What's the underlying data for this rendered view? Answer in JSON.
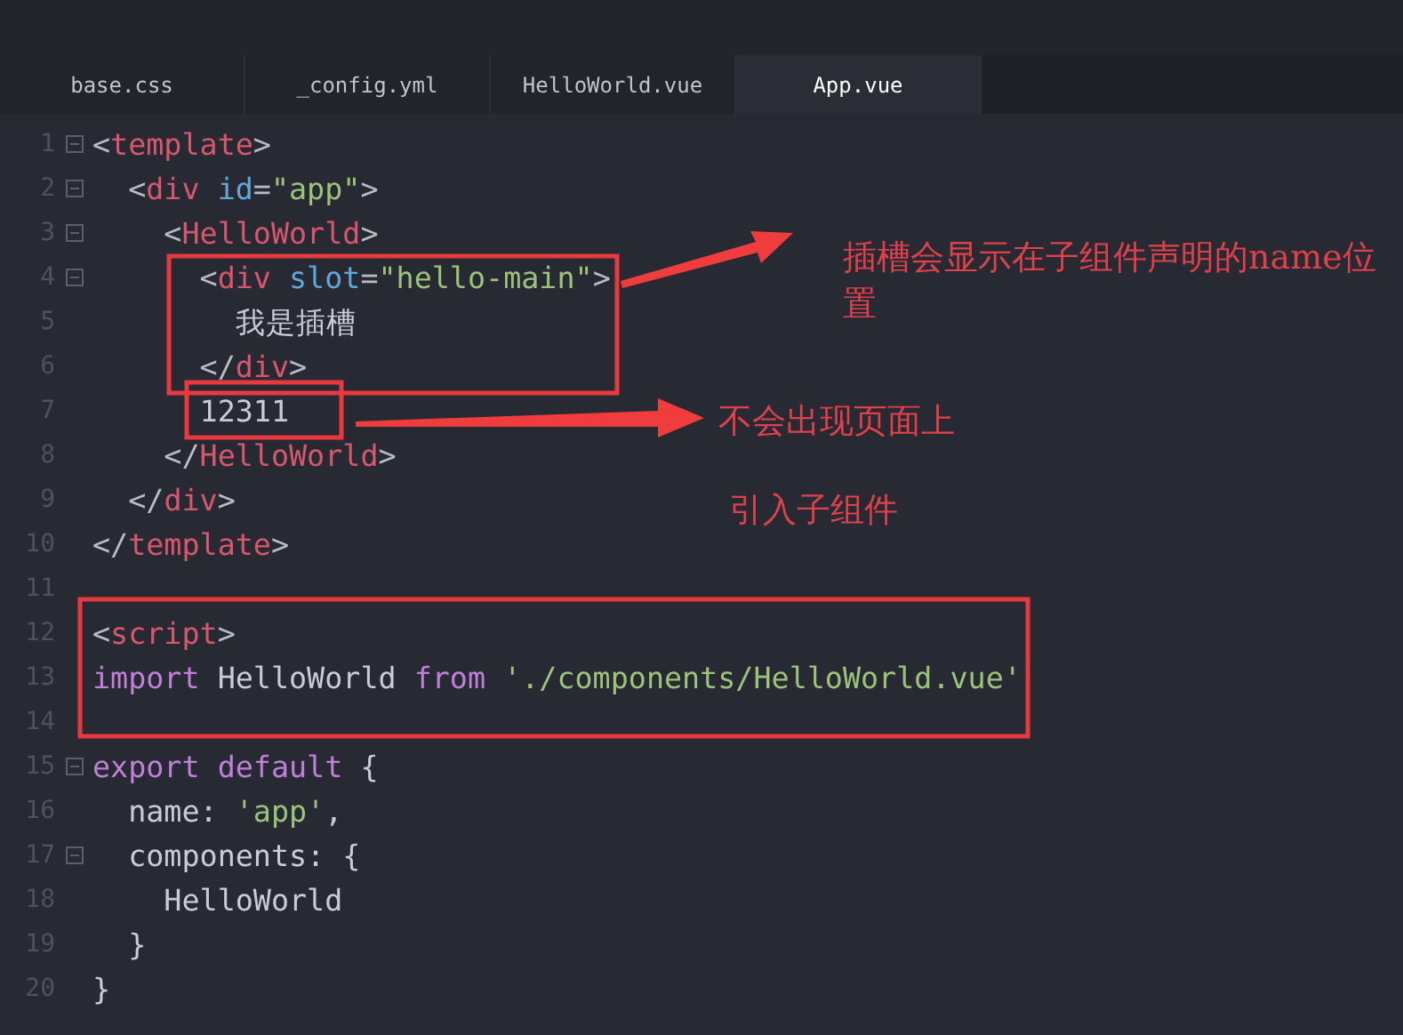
{
  "tabs": [
    {
      "label": "base.css",
      "selected": false
    },
    {
      "label": "_config.yml",
      "selected": false
    },
    {
      "label": "HelloWorld.vue",
      "selected": false
    },
    {
      "label": "App.vue",
      "selected": true
    }
  ],
  "code_lines": [
    {
      "number": "1",
      "fold": true,
      "tokens": [
        {
          "kind": "punct",
          "text": "<"
        },
        {
          "kind": "tag",
          "text": "template"
        },
        {
          "kind": "punct",
          "text": ">"
        }
      ]
    },
    {
      "number": "2",
      "fold": true,
      "tokens": [
        {
          "kind": "punct",
          "text": "  <"
        },
        {
          "kind": "tag",
          "text": "div"
        },
        {
          "kind": "attr",
          "text": " id"
        },
        {
          "kind": "punct",
          "text": "="
        },
        {
          "kind": "string",
          "text": "\"app\""
        },
        {
          "kind": "punct",
          "text": ">"
        }
      ]
    },
    {
      "number": "3",
      "fold": true,
      "tokens": [
        {
          "kind": "punct",
          "text": "    <"
        },
        {
          "kind": "tag",
          "text": "HelloWorld"
        },
        {
          "kind": "punct",
          "text": ">"
        }
      ]
    },
    {
      "number": "4",
      "fold": true,
      "tokens": [
        {
          "kind": "punct",
          "text": "      <"
        },
        {
          "kind": "tag",
          "text": "div"
        },
        {
          "kind": "attr",
          "text": " slot"
        },
        {
          "kind": "punct",
          "text": "="
        },
        {
          "kind": "string",
          "text": "\"hello-main\""
        },
        {
          "kind": "punct",
          "text": ">"
        }
      ]
    },
    {
      "number": "5",
      "fold": false,
      "tokens": [
        {
          "kind": "plain",
          "text": "        我是插槽"
        }
      ]
    },
    {
      "number": "6",
      "fold": false,
      "tokens": [
        {
          "kind": "punct",
          "text": "      </"
        },
        {
          "kind": "tag",
          "text": "div"
        },
        {
          "kind": "punct",
          "text": ">"
        }
      ]
    },
    {
      "number": "7",
      "fold": false,
      "tokens": [
        {
          "kind": "plain",
          "text": "      12311"
        }
      ]
    },
    {
      "number": "8",
      "fold": false,
      "tokens": [
        {
          "kind": "punct",
          "text": "    </"
        },
        {
          "kind": "tag",
          "text": "HelloWorld"
        },
        {
          "kind": "punct",
          "text": ">"
        }
      ]
    },
    {
      "number": "9",
      "fold": false,
      "tokens": [
        {
          "kind": "punct",
          "text": "  </"
        },
        {
          "kind": "tag",
          "text": "div"
        },
        {
          "kind": "punct",
          "text": ">"
        }
      ]
    },
    {
      "number": "10",
      "fold": false,
      "tokens": [
        {
          "kind": "punct",
          "text": "</"
        },
        {
          "kind": "tag",
          "text": "template"
        },
        {
          "kind": "punct",
          "text": ">"
        }
      ]
    },
    {
      "number": "11",
      "fold": false
    },
    {
      "number": "12",
      "fold": false,
      "tokens": [
        {
          "kind": "punct",
          "text": "<"
        },
        {
          "kind": "tag",
          "text": "script"
        },
        {
          "kind": "punct",
          "text": ">"
        }
      ]
    },
    {
      "number": "13",
      "fold": false,
      "tokens": [
        {
          "kind": "keyword",
          "text": "import"
        },
        {
          "kind": "plain",
          "text": " HelloWorld "
        },
        {
          "kind": "keyword",
          "text": "from"
        },
        {
          "kind": "string",
          "text": " './components/HelloWorld.vue'"
        }
      ]
    },
    {
      "number": "14",
      "fold": false
    },
    {
      "number": "15",
      "fold": true,
      "tokens": [
        {
          "kind": "keyword",
          "text": "export"
        },
        {
          "kind": "keyword",
          "text": " default"
        },
        {
          "kind": "plain",
          "text": " {"
        }
      ]
    },
    {
      "number": "16",
      "fold": false,
      "tokens": [
        {
          "kind": "plain",
          "text": "  name: "
        },
        {
          "kind": "string",
          "text": "'app'"
        },
        {
          "kind": "plain",
          "text": ","
        }
      ]
    },
    {
      "number": "17",
      "fold": true,
      "tokens": [
        {
          "kind": "plain",
          "text": "  components: {"
        }
      ]
    },
    {
      "number": "18",
      "fold": false,
      "tokens": [
        {
          "kind": "plain",
          "text": "    HelloWorld"
        }
      ]
    },
    {
      "number": "19",
      "fold": false,
      "tokens": [
        {
          "kind": "plain",
          "text": "  }"
        }
      ]
    },
    {
      "number": "20",
      "fold": false,
      "tokens": [
        {
          "kind": "plain",
          "text": "}"
        }
      ]
    }
  ],
  "annotations": [
    "插槽会显示在子组件声明的name位置",
    "不会出现页面上",
    "引入子组件"
  ]
}
